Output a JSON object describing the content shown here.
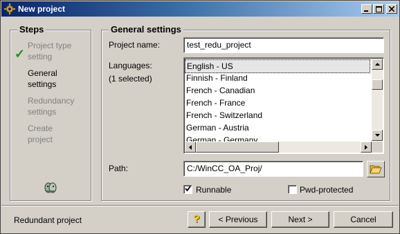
{
  "window": {
    "title": "New project"
  },
  "steps": {
    "heading": "Steps",
    "items": [
      {
        "line1": "Project type",
        "line2": "setting",
        "state": "done"
      },
      {
        "line1": "General",
        "line2": "settings",
        "state": "current"
      },
      {
        "line1": "Redundancy",
        "line2": "settings",
        "state": "pending"
      },
      {
        "line1": "Create",
        "line2": "project",
        "state": "pending"
      }
    ]
  },
  "general": {
    "heading": "General settings",
    "project_name_label": "Project name:",
    "project_name_value": "test_redu_project",
    "languages_label": "Languages:",
    "languages_count": "(1 selected)",
    "languages": [
      "English - US",
      "Finnish - Finland",
      "French - Canadian",
      "French - France",
      "French - Switzerland",
      "German - Austria",
      "German - Germany"
    ],
    "selected_language": "English - US",
    "path_label": "Path:",
    "path_value": "C:/WinCC_OA_Proj/",
    "runnable_label": "Runnable",
    "runnable_checked": true,
    "pwd_label": "Pwd-protected",
    "pwd_checked": false
  },
  "footer": {
    "status_text": "Redundant project",
    "help_label": "?",
    "previous_label": "< Previous",
    "next_label": "Next >",
    "cancel_label": "Cancel"
  },
  "colors": {
    "titlebar_start": "#0a246a",
    "titlebar_end": "#a6caf0",
    "check_green": "#1d8a1d",
    "help_yellow": "#f5c518"
  }
}
